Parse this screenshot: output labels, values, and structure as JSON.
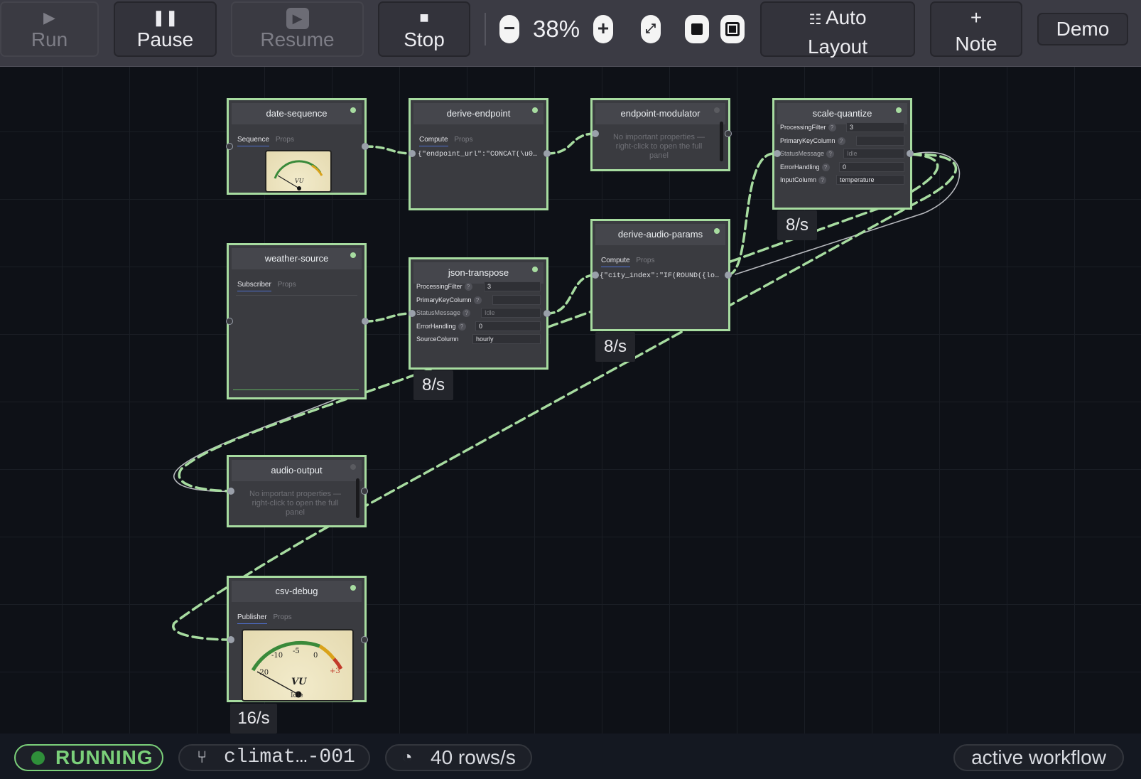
{
  "toolbar": {
    "run_label": "Run",
    "pause_label": "Pause",
    "resume_label": "Resume",
    "stop_label": "Stop",
    "zoom_level": "38%",
    "zoom_out_symbol": "−",
    "zoom_in_symbol": "+",
    "auto_layout_line1": "Auto",
    "auto_layout_line2": "Layout",
    "note_line1": "+",
    "note_line2": "Note",
    "demo_label": "Demo",
    "icons": [
      "play-icon",
      "pause-icon",
      "resume-icon",
      "stop-icon",
      "zoom-out-icon",
      "zoom-in-icon",
      "fit-view-icon",
      "square-icon",
      "frame-icon",
      "auto-layout-icon",
      "plus-icon"
    ]
  },
  "nodes": {
    "date_sequence": {
      "title": "date-sequence",
      "tab_active": "Sequence",
      "tab_props": "Props"
    },
    "derive_endpoint": {
      "title": "derive-endpoint",
      "tab_active": "Compute",
      "tab_props": "Props",
      "code": "{\"endpoint_url\":\"CONCAT(\\u0027…"
    },
    "endpoint_modulator": {
      "title": "endpoint-modulator",
      "note": "No important properties — right-click to open the full panel"
    },
    "scale_quantize": {
      "title": "scale-quantize",
      "rate": "8/s",
      "props": [
        {
          "key": "ProcessingFilter",
          "value": "3"
        },
        {
          "key": "PrimaryKeyColumn",
          "value": ""
        },
        {
          "key": "StatusMessage",
          "value": "Idle"
        },
        {
          "key": "ErrorHandling",
          "value": "0"
        },
        {
          "key": "InputColumn",
          "value": "temperature"
        }
      ]
    },
    "weather_source": {
      "title": "weather-source",
      "tab_active": "Subscriber",
      "tab_props": "Props"
    },
    "json_transpose": {
      "title": "json-transpose",
      "rate": "8/s",
      "props": [
        {
          "key": "ProcessingFilter",
          "value": "3"
        },
        {
          "key": "PrimaryKeyColumn",
          "value": ""
        },
        {
          "key": "StatusMessage",
          "value": "Idle"
        },
        {
          "key": "ErrorHandling",
          "value": "0"
        },
        {
          "key": "SourceColumn",
          "value": "hourly"
        }
      ]
    },
    "derive_audio_params": {
      "title": "derive-audio-params",
      "tab_active": "Compute",
      "tab_props": "Props",
      "code": "{\"city_index\":\"IF(ROUND({longi…",
      "rate": "8/s"
    },
    "audio_output": {
      "title": "audio-output",
      "note": "No important properties — right-click to open the full panel"
    },
    "csv_debug": {
      "title": "csv-debug",
      "tab_active": "Publisher",
      "tab_props": "Props",
      "rate": "16/s",
      "meter": {
        "scale_labels": [
          "-20",
          "-10",
          "-5",
          "0",
          "+3"
        ],
        "unit": "VU",
        "state": "Idle"
      }
    }
  },
  "statusbar": {
    "state": "RUNNING",
    "workflow": "climat…-001",
    "throughput": "40 rows/s",
    "mode": "active workflow"
  },
  "colors": {
    "accent_green": "#a7dca0",
    "running_green": "#7bd07a",
    "canvas_bg": "#0e1117",
    "toolbar_bg": "#3b3b44",
    "node_bg": "#3a3b40"
  }
}
